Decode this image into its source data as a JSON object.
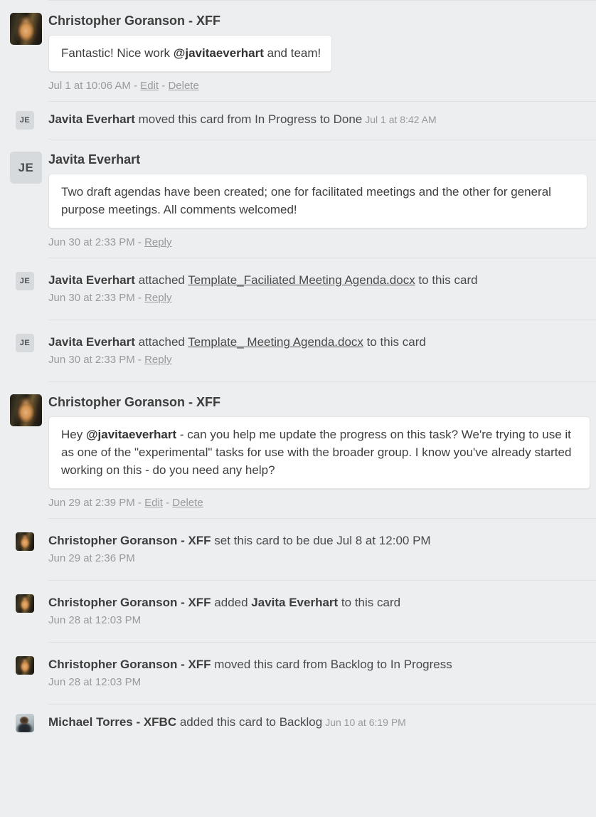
{
  "feed": {
    "entries": [
      {
        "type": "comment",
        "avatar": "photo-christopher",
        "author": "Christopher Goranson - XFF",
        "body_pre": "Fantastic! Nice work ",
        "body_mention": "@javitaeverhart",
        "body_post": " and team!",
        "timestamp": "Jul 1 at 10:06 AM",
        "sep1": " - ",
        "action_edit": "Edit",
        "sep2": " - ",
        "action_delete": "Delete"
      },
      {
        "type": "action",
        "avatar": "initials-JE",
        "initials": "JE",
        "name": "Javita Everhart",
        "text": " moved this card from In Progress to Done",
        "inline_time": "Jul 1 at 8:42 AM"
      },
      {
        "type": "comment",
        "avatar": "initials-JE",
        "initials": "JE",
        "author": "Javita Everhart",
        "body_pre": "Two draft agendas have been created; one for facilitated meetings and the other for general purpose meetings. All comments welcomed!",
        "timestamp": "Jun 30 at 2:33 PM",
        "sep1": " - ",
        "action_reply": "Reply"
      },
      {
        "type": "attachment",
        "avatar": "initials-JE",
        "initials": "JE",
        "name": "Javita Everhart",
        "verb": " attached ",
        "file": "Template_Faciliated Meeting Agenda.docx",
        "suffix": " to this card",
        "timestamp": "Jun 30 at 2:33 PM",
        "sep1": " - ",
        "action_reply": "Reply"
      },
      {
        "type": "attachment",
        "avatar": "initials-JE",
        "initials": "JE",
        "name": "Javita Everhart",
        "verb": " attached ",
        "file": "Template_ Meeting Agenda.docx",
        "suffix": " to this card",
        "timestamp": "Jun 30 at 2:33 PM",
        "sep1": " - ",
        "action_reply": "Reply"
      },
      {
        "type": "comment",
        "avatar": "photo-christopher",
        "author": "Christopher Goranson - XFF",
        "body_pre": "Hey ",
        "body_mention": "@javitaeverhart",
        "body_post": " - can you help me update the progress on this task? We're trying to use it as one of the \"experimental\" tasks for use with the broader group. I know you've already started working on this - do you need any help?",
        "timestamp": "Jun 29 at 2:39 PM",
        "sep1": " - ",
        "action_edit": "Edit",
        "sep2": " - ",
        "action_delete": "Delete"
      },
      {
        "type": "action",
        "avatar": "photo-christopher",
        "name": "Christopher Goranson - XFF",
        "text": " set this card to be due Jul 8 at 12:00 PM",
        "sub_time": "Jun 29 at 2:36 PM"
      },
      {
        "type": "action",
        "avatar": "photo-christopher",
        "name": "Christopher Goranson - XFF",
        "text_pre": " added ",
        "member": "Javita Everhart",
        "text_post": " to this card",
        "sub_time": "Jun 28 at 12:03 PM"
      },
      {
        "type": "action",
        "avatar": "photo-christopher",
        "name": "Christopher Goranson - XFF",
        "text": " moved this card from Backlog to In Progress",
        "sub_time": "Jun 28 at 12:03 PM"
      },
      {
        "type": "action",
        "avatar": "photo-michael",
        "name": "Michael Torres - XFBC",
        "text": " added this card to Backlog",
        "inline_time": "Jun 10 at 6:19 PM"
      }
    ]
  },
  "colors": {
    "page_background": "#edeef0",
    "bubble_background": "#ffffff",
    "divider": "#e0e1e3",
    "primary_text": "#3d3d3d",
    "muted_text": "#9a9a9a",
    "initials_avatar_background": "#d7dadd"
  }
}
